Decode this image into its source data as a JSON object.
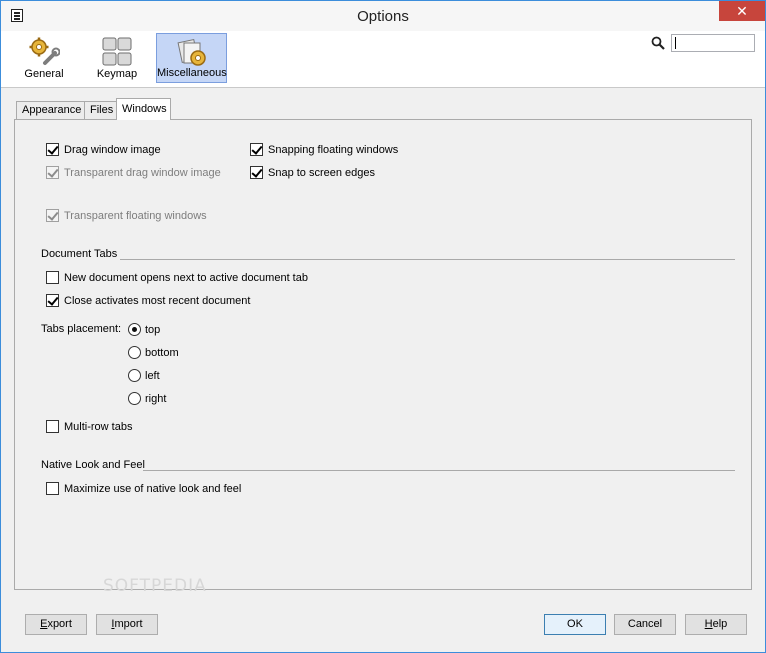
{
  "window": {
    "title": "Options",
    "close_glyph": "✕"
  },
  "toolbar": {
    "categories": [
      {
        "label": "General",
        "icon": "wrench-gear-icon"
      },
      {
        "label": "Keymap",
        "icon": "keyboard-icon"
      },
      {
        "label": "Miscellaneous",
        "icon": "misc-gear-icon",
        "selected": true
      }
    ],
    "search": {
      "icon": "search-icon",
      "value": ""
    }
  },
  "tabs": [
    {
      "label": "Appearance"
    },
    {
      "label": "Files"
    },
    {
      "label": "Windows",
      "active": true
    }
  ],
  "windows": {
    "drag_window_image": {
      "label": "Drag window image",
      "checked": true
    },
    "transparent_drag_window_image": {
      "label": "Transparent drag window image",
      "checked": true,
      "enabled": false
    },
    "transparent_floating_windows": {
      "label": "Transparent floating windows",
      "checked": true,
      "enabled": false
    },
    "snapping_floating_windows": {
      "label": "Snapping floating windows",
      "checked": true
    },
    "snap_to_screen_edges": {
      "label": "Snap to screen edges",
      "checked": true
    }
  },
  "document_tabs": {
    "heading": "Document Tabs",
    "new_document_opens_next": {
      "label": "New document opens next to active document tab",
      "checked": false
    },
    "close_activates_recent": {
      "label": "Close activates most recent document",
      "checked": true
    },
    "tabs_placement": {
      "label": "Tabs placement:",
      "options": [
        "top",
        "bottom",
        "left",
        "right"
      ],
      "selected": "top"
    },
    "multi_row_tabs": {
      "label": "Multi-row tabs",
      "checked": false
    }
  },
  "native": {
    "heading": "Native Look and Feel",
    "maximize_native": {
      "label": "Maximize use of native look and feel",
      "checked": false
    }
  },
  "watermark": "SOFTPEDIA",
  "footer": {
    "export": {
      "mnemonic": "E",
      "rest": "xport"
    },
    "import": {
      "mnemonic": "I",
      "rest": "mport"
    },
    "ok": "OK",
    "cancel": "Cancel",
    "help": {
      "mnemonic": "H",
      "rest": "elp"
    }
  },
  "colors": {
    "selected_category_bg": "#c5d6f6",
    "window_border": "#3c8ddb",
    "close_button": "#c7453c"
  }
}
